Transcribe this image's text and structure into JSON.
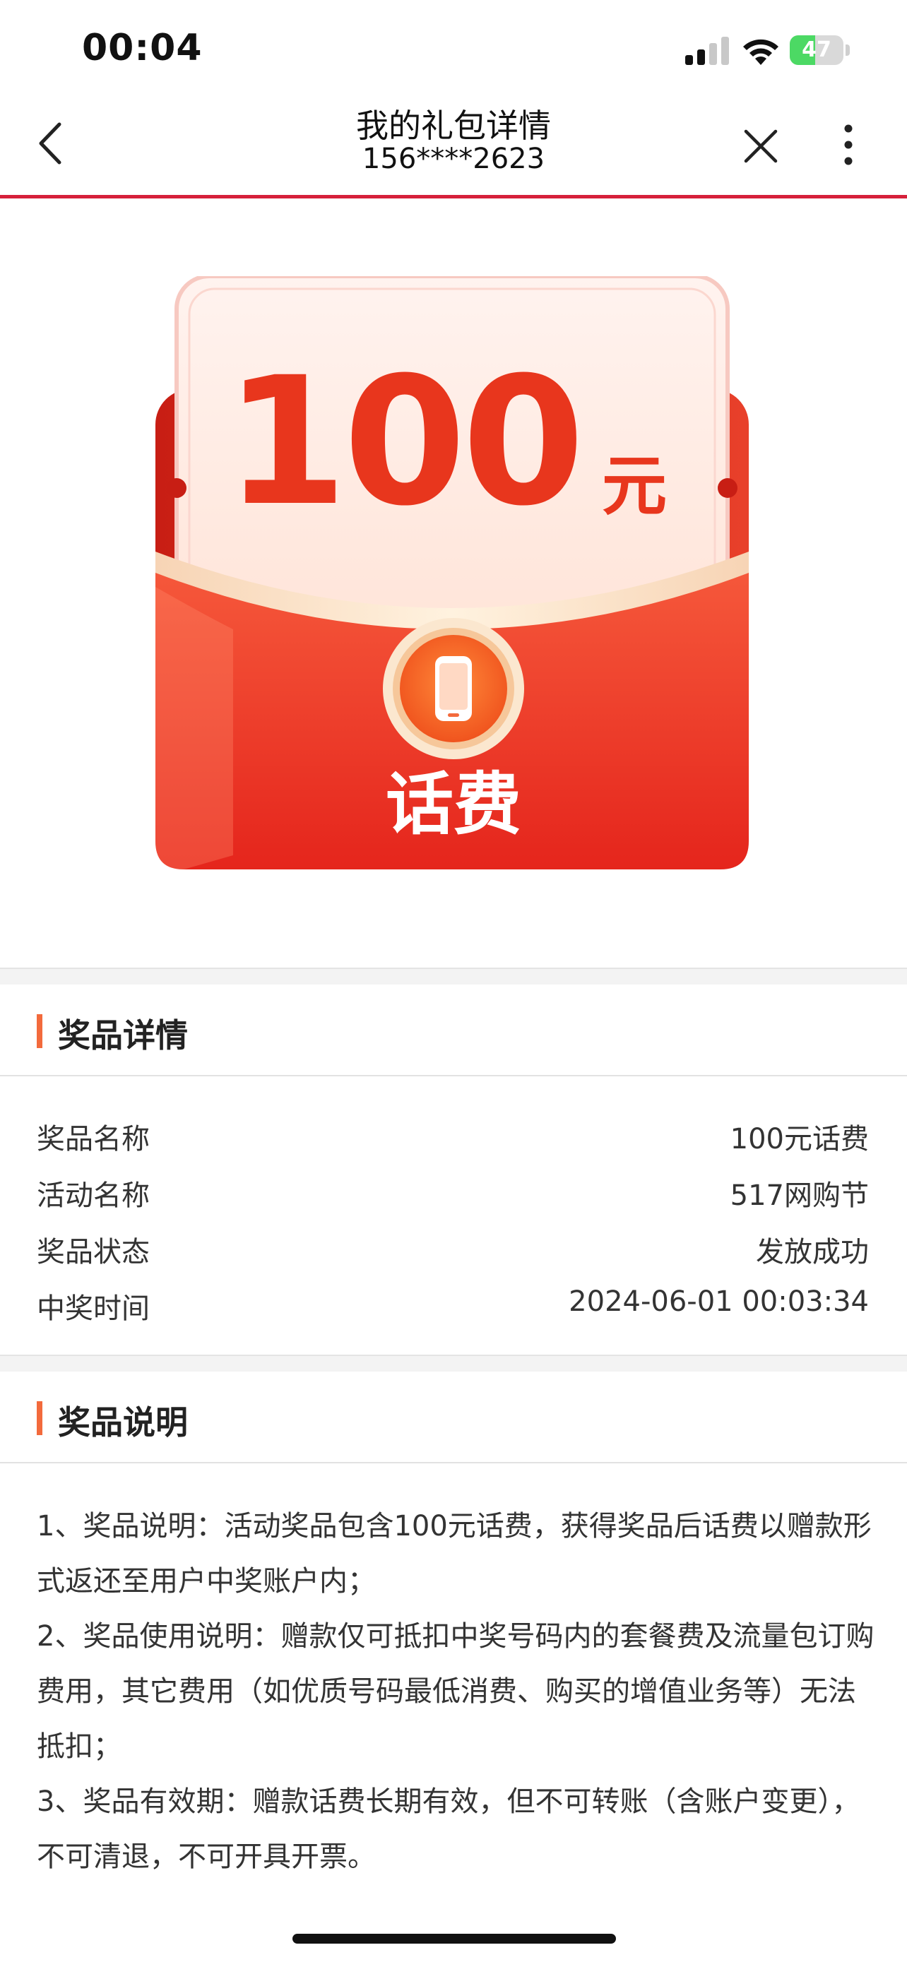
{
  "status_bar": {
    "time": "00:04",
    "battery": "47",
    "battery_level": 0.47
  },
  "nav": {
    "title": "我的礼包详情",
    "subtitle": "156****2623"
  },
  "hero": {
    "amount": "100",
    "unit": "元",
    "type": "话费"
  },
  "prize_details": {
    "title": "奖品详情",
    "rows": [
      {
        "label": "奖品名称",
        "value": "100元话费"
      },
      {
        "label": "活动名称",
        "value": "517网购节"
      },
      {
        "label": "奖品状态",
        "value": "发放成功"
      },
      {
        "label": "中奖时间",
        "value": "2024-06-01 00:03:34"
      }
    ]
  },
  "prize_description": {
    "title": "奖品说明",
    "items": [
      "1、奖品说明：活动奖品包含100元话费，获得奖品后话费以赠款形式返还至用户中奖账户内；",
      "2、奖品使用说明：赠款仅可抵扣中奖号码内的套餐费及流量包订购费用，其它费用（如优质号码最低消费、购买的增值业务等）无法抵扣；",
      "3、奖品有效期：赠款话费长期有效，但不可转账（含账户变更），不可清退，不可开具开票。"
    ]
  },
  "colors": {
    "accent": "#d6203a",
    "amount": "#e8361d",
    "section_bar": "#f36a3c",
    "battery": "#4cd964"
  }
}
